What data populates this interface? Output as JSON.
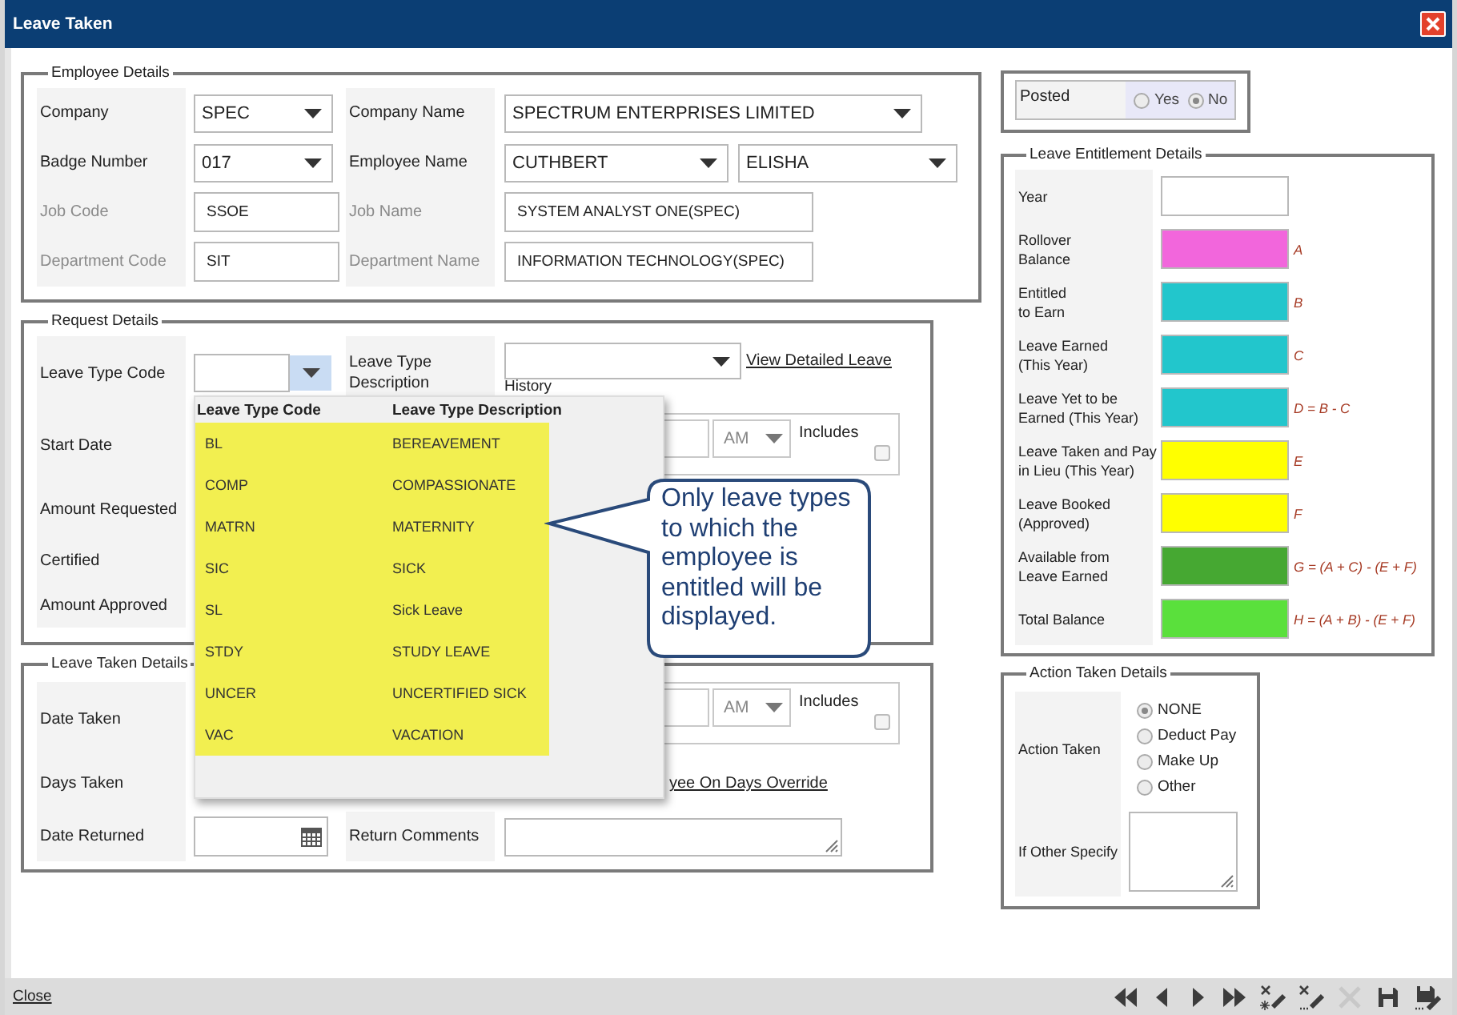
{
  "window": {
    "title": "Leave Taken"
  },
  "employee_details": {
    "legend": "Employee Details",
    "rows": [
      {
        "label": "Company",
        "disabled": false,
        "field": {
          "kind": "select",
          "value": "SPEC"
        },
        "label_2": "Company Name",
        "fields_2": [
          {
            "kind": "select",
            "value": "SPECTRUM ENTERPRISES LIMITED"
          }
        ]
      },
      {
        "label": "Badge Number",
        "disabled": false,
        "field": {
          "kind": "select",
          "value": "017"
        },
        "label_2": "Employee Name",
        "fields_2": [
          {
            "kind": "select",
            "value": "CUTHBERT"
          },
          {
            "kind": "select",
            "value": "ELISHA"
          }
        ]
      },
      {
        "label": "Job Code",
        "disabled": true,
        "field": {
          "kind": "text",
          "value": "SSOE"
        },
        "label_2": "Job Name",
        "fields_2": [
          {
            "kind": "text",
            "value": "SYSTEM ANALYST ONE(SPEC)"
          }
        ]
      },
      {
        "label": "Department Code",
        "disabled": true,
        "field": {
          "kind": "text",
          "value": "SIT"
        },
        "label_2": "Department Name",
        "fields_2": [
          {
            "kind": "text",
            "value": "INFORMATION TECHNOLOGY(SPEC)"
          }
        ]
      }
    ]
  },
  "request_details": {
    "legend": "Request Details",
    "leave_type_code": {
      "label": "Leave Type Code"
    },
    "leave_type_description": {
      "label": "Leave Type Description",
      "link": "View Detailed Leave",
      "link_continued": "History"
    },
    "start_date": {
      "label": "Start Date",
      "time": "AM",
      "checkbox_label": "Includes",
      "checked": false
    },
    "amount_requested": {
      "label": "Amount Requested"
    },
    "certified": {
      "label": "Certified"
    },
    "amount_approved": {
      "label": "Amount Approved"
    }
  },
  "leave_taken_details": {
    "legend": "Leave Taken Details",
    "date_taken": {
      "label": "Date Taken",
      "time": "AM",
      "checkbox_label": "Includes",
      "checked": false
    },
    "days_taken": {
      "label": "Days Taken",
      "link": "yee On Days Override"
    },
    "date_returned": {
      "label": "Date Returned"
    },
    "return_comments": {
      "label": "Return Comments"
    }
  },
  "leave_type_dropdown": {
    "columns": [
      "Leave Type Code",
      "Leave Type Description"
    ],
    "rows": [
      {
        "code": "BL",
        "description": "BEREAVEMENT"
      },
      {
        "code": "COMP",
        "description": "COMPASSIONATE"
      },
      {
        "code": "MATRN",
        "description": "MATERNITY"
      },
      {
        "code": "SIC",
        "description": "SICK"
      },
      {
        "code": "SL",
        "description": "Sick Leave"
      },
      {
        "code": "STDY",
        "description": "STUDY LEAVE"
      },
      {
        "code": "UNCER",
        "description": "UNCERTIFIED SICK"
      },
      {
        "code": "VAC",
        "description": "VACATION"
      }
    ]
  },
  "callout": {
    "text": "Only leave types to which the employee is entitled will be displayed."
  },
  "posted": {
    "label": "Posted",
    "options": [
      {
        "label": "Yes",
        "selected": false
      },
      {
        "label": "No",
        "selected": true
      }
    ]
  },
  "leave_entitlement_details": {
    "legend": "Leave Entitlement Details",
    "rows": [
      {
        "label": "Year"
      },
      {
        "label": "Rollover\nBalance",
        "color": "#f266dc",
        "formula": "A"
      },
      {
        "label": "Entitled\nto Earn",
        "color": "#22c6cc",
        "formula": "B"
      },
      {
        "label": "Leave Earned\n(This Year)",
        "color": "#22c6cc",
        "formula": "C"
      },
      {
        "label": "Leave Yet to be\nEarned (This Year)",
        "color": "#22c6cc",
        "formula": "D = B - C"
      },
      {
        "label": "Leave Taken and Pay\nin Lieu (This Year)",
        "color": "#ffff00",
        "formula": "E"
      },
      {
        "label": "Leave Booked\n(Approved)",
        "color": "#ffff00",
        "formula": "F"
      },
      {
        "label": "Available from\nLeave Earned",
        "color": "#46a832",
        "formula": "G = (A + C) - (E + F)"
      },
      {
        "label": "Total Balance",
        "color": "#5ae03c",
        "formula": "H = (A + B) - (E + F)"
      }
    ]
  },
  "action_taken_details": {
    "legend": "Action Taken Details",
    "label": "Action Taken",
    "options": [
      {
        "label": "NONE",
        "selected": true
      },
      {
        "label": "Deduct Pay",
        "selected": false
      },
      {
        "label": "Make Up",
        "selected": false
      },
      {
        "label": "Other",
        "selected": false
      }
    ],
    "specify_label": "If Other Specify"
  },
  "footer": {
    "close": "Close"
  }
}
